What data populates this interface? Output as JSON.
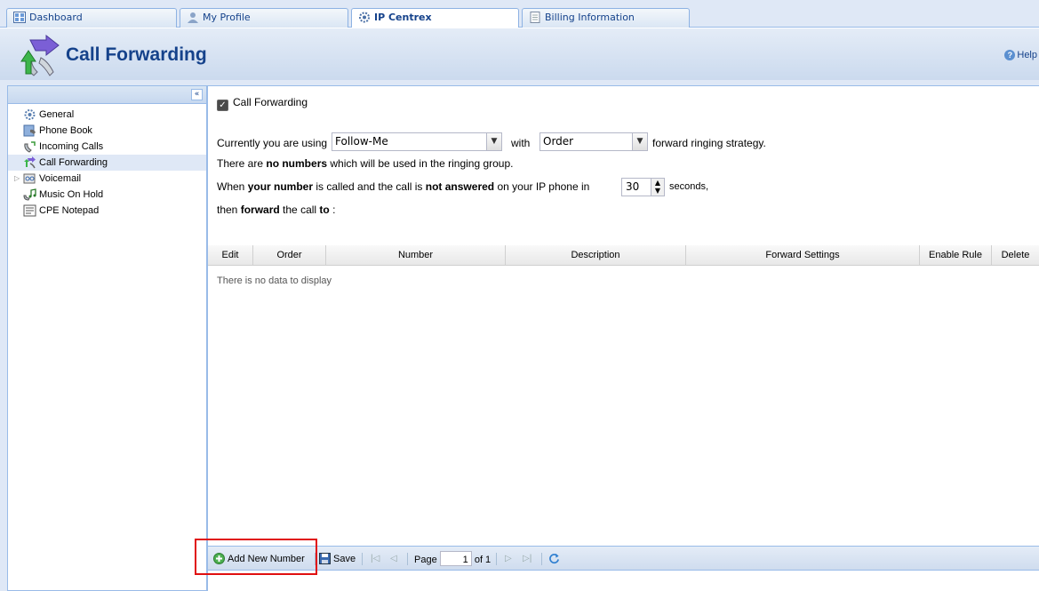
{
  "tabs": [
    {
      "label": "Dashboard",
      "icon": "dashboard-icon"
    },
    {
      "label": "My Profile",
      "icon": "user-icon"
    },
    {
      "label": "IP Centrex",
      "icon": "gear-icon"
    },
    {
      "label": "Billing Information",
      "icon": "document-icon"
    }
  ],
  "header": {
    "title": "Call Forwarding",
    "help_label": "Help"
  },
  "sidebar": {
    "items": [
      {
        "label": "General",
        "icon": "gear-icon"
      },
      {
        "label": "Phone Book",
        "icon": "phone-book-icon"
      },
      {
        "label": "Incoming Calls",
        "icon": "incoming-call-icon"
      },
      {
        "label": "Call Forwarding",
        "icon": "call-forward-icon"
      },
      {
        "label": "Voicemail",
        "icon": "voicemail-icon"
      },
      {
        "label": "Music On Hold",
        "icon": "music-icon"
      },
      {
        "label": "CPE Notepad",
        "icon": "notepad-icon"
      }
    ]
  },
  "form": {
    "checkbox_label": "Call Forwarding",
    "using_prefix": "Currently you are using",
    "strategy_value": "Follow-Me",
    "with_label": "with",
    "order_value": "Order",
    "strategy_suffix": "forward ringing strategy.",
    "line2_a": "There are ",
    "line2_b": "no numbers",
    "line2_c": " which will be used in the ringing group.",
    "line3_a": "When ",
    "line3_b": "your number",
    "line3_c": " is called and the call is ",
    "line3_d": "not answered",
    "line3_e": " on your IP phone in",
    "seconds_value": "30",
    "seconds_label": "seconds,",
    "line4_a": "then ",
    "line4_b": "forward",
    "line4_c": " the call ",
    "line4_d": "to",
    "line4_e": " :"
  },
  "grid": {
    "columns": [
      "Edit",
      "Order",
      "Number",
      "Description",
      "Forward Settings",
      "Enable Rule",
      "Delete"
    ],
    "empty_text": "There is no data to display"
  },
  "toolbar": {
    "add_label": "Add New Number",
    "save_label": "Save",
    "page_label": "Page",
    "page_value": "1",
    "of_label": "of 1"
  }
}
